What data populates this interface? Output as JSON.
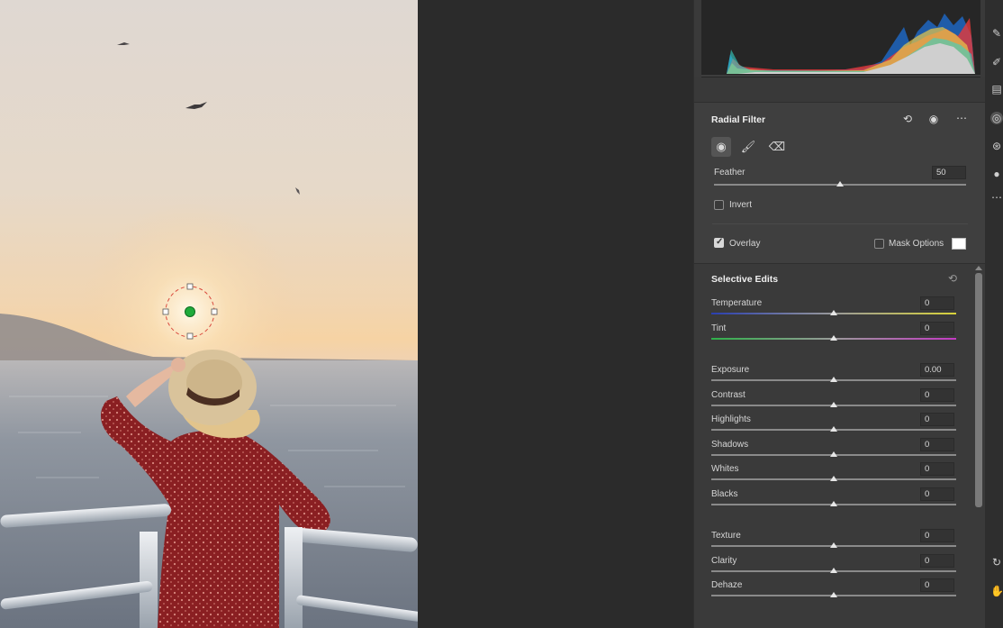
{
  "radial_filter": {
    "title": "Radial Filter",
    "feather_label": "Feather",
    "feather_value": "50",
    "feather_level": 0.5,
    "invert_label": "Invert",
    "invert_checked": false,
    "overlay_label": "Overlay",
    "overlay_checked": true,
    "mask_options_label": "Mask Options",
    "mask_options_checked": false,
    "overlay_color": "#ffffff"
  },
  "selective_edits": {
    "title": "Selective Edits",
    "sliders": [
      {
        "id": "temperature",
        "label": "Temperature",
        "value": "0",
        "level": 0.5
      },
      {
        "id": "tint",
        "label": "Tint",
        "value": "0",
        "level": 0.5
      },
      {
        "id": "exposure",
        "label": "Exposure",
        "value": "0.00",
        "level": 0.5
      },
      {
        "id": "contrast",
        "label": "Contrast",
        "value": "0",
        "level": 0.5
      },
      {
        "id": "highlights",
        "label": "Highlights",
        "value": "0",
        "level": 0.5
      },
      {
        "id": "shadows",
        "label": "Shadows",
        "value": "0",
        "level": 0.5
      },
      {
        "id": "whites",
        "label": "Whites",
        "value": "0",
        "level": 0.5
      },
      {
        "id": "blacks",
        "label": "Blacks",
        "value": "0",
        "level": 0.5
      },
      {
        "id": "texture",
        "label": "Texture",
        "value": "0",
        "level": 0.5
      },
      {
        "id": "clarity",
        "label": "Clarity",
        "value": "0",
        "level": 0.5
      },
      {
        "id": "dehaze",
        "label": "Dehaze",
        "value": "0",
        "level": 0.5
      }
    ]
  },
  "toolbar_icons": [
    "healing-brush-icon",
    "adjustment-brush-icon",
    "graduated-filter-icon",
    "radial-filter-icon",
    "red-eye-icon",
    "mask-icon",
    "more-icon",
    "rotate-icon",
    "hand-icon"
  ],
  "colors": {
    "panel_bg": "#3a3a3a",
    "section_bg": "#3f3f3f",
    "canvas_bg": "#2b2b2b",
    "filter_pin": "#1faa3a",
    "filter_outline": "#d9493c"
  }
}
